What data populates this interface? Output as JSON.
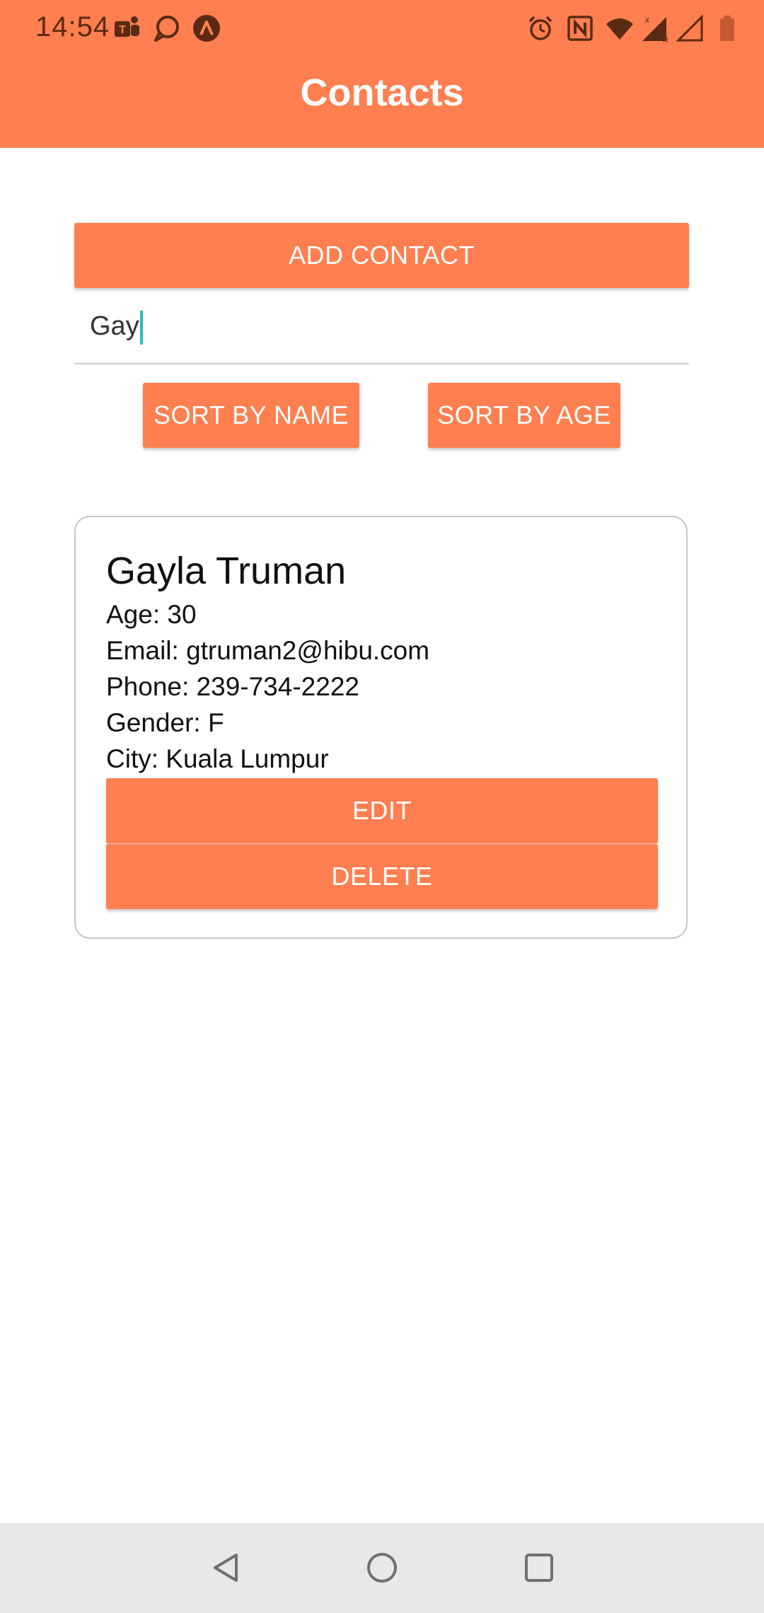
{
  "status_bar": {
    "time": "14:54",
    "left_icons": [
      "teams-icon",
      "chat-bubble-icon",
      "app-a-icon"
    ],
    "right_icons": [
      "alarm-icon",
      "nfc-icon",
      "wifi-icon",
      "signal-r-icon",
      "signal-icon",
      "battery-icon"
    ]
  },
  "app_bar": {
    "title": "Contacts",
    "color": "#ff7f50"
  },
  "actions": {
    "add_contact": "ADD CONTACT",
    "sort_by_name": "SORT BY NAME",
    "sort_by_age": "SORT BY AGE"
  },
  "search": {
    "value": "Gay"
  },
  "contacts": [
    {
      "name": "Gayla Truman",
      "age": "Age: 30",
      "email": "Email: gtruman2@hibu.com",
      "phone": "Phone: 239-734-2222",
      "gender": "Gender: F",
      "city": "City: Kuala Lumpur",
      "edit_label": "EDIT",
      "delete_label": "DELETE"
    }
  ],
  "nav_bar": {
    "icons": [
      "back-icon",
      "home-icon",
      "recents-icon"
    ]
  }
}
